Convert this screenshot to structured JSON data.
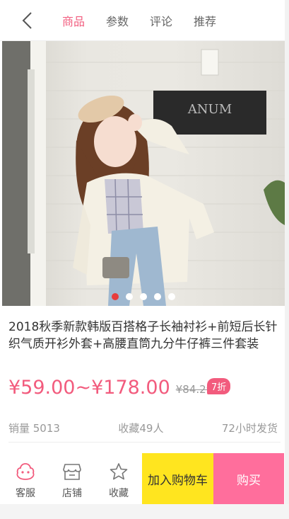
{
  "header": {
    "back_icon": "chevron-left-icon",
    "tabs": [
      {
        "label": "商品",
        "active": true
      },
      {
        "label": "参数",
        "active": false
      },
      {
        "label": "评论",
        "active": false
      },
      {
        "label": "推荐",
        "active": false
      }
    ]
  },
  "hero": {
    "sign_text": "ANUM",
    "carousel_total": 5,
    "carousel_active": 1
  },
  "product": {
    "title": "2018秋季新款韩版百搭格子长袖衬衫+前短后长针织气质开衫外套+高腰直筒九分牛仔裤三件套装",
    "price": "¥59.00~¥178.00",
    "original_price": "¥84.29",
    "discount": "7折"
  },
  "stats": {
    "sales": "销量 5013",
    "favorites": "收藏49人",
    "shipping": "72小时发货"
  },
  "bottom_bar": {
    "service_label": "客服",
    "shop_label": "店铺",
    "favorite_label": "收藏",
    "cart_label": "加入购物车",
    "buy_label": "购买"
  },
  "colors": {
    "accent_pink": "#f25b7d",
    "cart_yellow": "#ffe51f",
    "buy_pink": "#ff6e9c",
    "dot_active": "#e73c3c"
  }
}
